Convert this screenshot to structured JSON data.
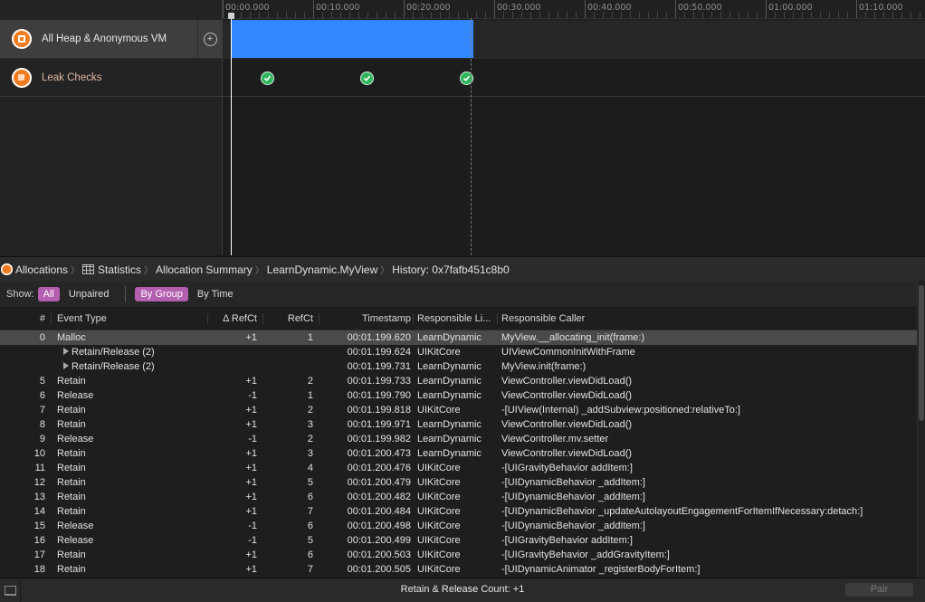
{
  "timeline": {
    "ticks": [
      "00:00.000",
      "00:10.000",
      "00:20.000",
      "00:30.000",
      "00:40.000",
      "00:50.000",
      "01:00.000",
      "01:10.000"
    ]
  },
  "tracks": [
    {
      "label": "All Heap & Anonymous VM",
      "icon": "allocations-icon"
    },
    {
      "label": "Leak Checks",
      "icon": "leaks-icon"
    }
  ],
  "colors": {
    "accent_bar": "#3287ff",
    "instrument_orange": "#f07c21",
    "leak_green": "#2fb45a",
    "filter_active": "#b45eb0"
  },
  "breadcrumb": {
    "items": [
      "Allocations",
      "Statistics",
      "Allocation Summary",
      "LearnDynamic.MyView",
      "History: 0x7fafb451c8b0"
    ]
  },
  "filter": {
    "show_label": "Show:",
    "all": "All",
    "unpaired": "Unpaired",
    "by_group": "By Group",
    "by_time": "By Time"
  },
  "table": {
    "headers": [
      "#",
      "Event Type",
      "Δ RefCt",
      "RefCt",
      "Timestamp",
      "Responsible Li...",
      "Responsible Caller"
    ],
    "rows": [
      {
        "num": "0",
        "event": "Malloc",
        "delta": "+1",
        "refct": "1",
        "ts": "00:01.199.620",
        "lib": "LearnDynamic",
        "caller": "MyView.__allocating_init(frame:)",
        "selected": true
      },
      {
        "num": "",
        "event": "Retain/Release (2)",
        "delta": "",
        "refct": "",
        "ts": "00:01.199.624",
        "lib": "UIKitCore",
        "caller": "UIViewCommonInitWithFrame",
        "group": true
      },
      {
        "num": "",
        "event": "Retain/Release (2)",
        "delta": "",
        "refct": "",
        "ts": "00:01.199.731",
        "lib": "LearnDynamic",
        "caller": "MyView.init(frame:)",
        "group": true
      },
      {
        "num": "5",
        "event": "Retain",
        "delta": "+1",
        "refct": "2",
        "ts": "00:01.199.733",
        "lib": "LearnDynamic",
        "caller": "ViewController.viewDidLoad()"
      },
      {
        "num": "6",
        "event": "Release",
        "delta": "-1",
        "refct": "1",
        "ts": "00:01.199.790",
        "lib": "LearnDynamic",
        "caller": "ViewController.viewDidLoad()"
      },
      {
        "num": "7",
        "event": "Retain",
        "delta": "+1",
        "refct": "2",
        "ts": "00:01.199.818",
        "lib": "UIKitCore",
        "caller": "-[UIView(Internal) _addSubview:positioned:relativeTo:]"
      },
      {
        "num": "8",
        "event": "Retain",
        "delta": "+1",
        "refct": "3",
        "ts": "00:01.199.971",
        "lib": "LearnDynamic",
        "caller": "ViewController.viewDidLoad()"
      },
      {
        "num": "9",
        "event": "Release",
        "delta": "-1",
        "refct": "2",
        "ts": "00:01.199.982",
        "lib": "LearnDynamic",
        "caller": "ViewController.mv.setter"
      },
      {
        "num": "10",
        "event": "Retain",
        "delta": "+1",
        "refct": "3",
        "ts": "00:01.200.473",
        "lib": "LearnDynamic",
        "caller": "ViewController.viewDidLoad()"
      },
      {
        "num": "11",
        "event": "Retain",
        "delta": "+1",
        "refct": "4",
        "ts": "00:01.200.476",
        "lib": "UIKitCore",
        "caller": "-[UIGravityBehavior addItem:]"
      },
      {
        "num": "12",
        "event": "Retain",
        "delta": "+1",
        "refct": "5",
        "ts": "00:01.200.479",
        "lib": "UIKitCore",
        "caller": "-[UIDynamicBehavior _addItem:]"
      },
      {
        "num": "13",
        "event": "Retain",
        "delta": "+1",
        "refct": "6",
        "ts": "00:01.200.482",
        "lib": "UIKitCore",
        "caller": "-[UIDynamicBehavior _addItem:]"
      },
      {
        "num": "14",
        "event": "Retain",
        "delta": "+1",
        "refct": "7",
        "ts": "00:01.200.484",
        "lib": "UIKitCore",
        "caller": "-[UIDynamicBehavior _updateAutolayoutEngagementForItemIfNecessary:detach:]"
      },
      {
        "num": "15",
        "event": "Release",
        "delta": "-1",
        "refct": "6",
        "ts": "00:01.200.498",
        "lib": "UIKitCore",
        "caller": "-[UIDynamicBehavior _addItem:]"
      },
      {
        "num": "16",
        "event": "Release",
        "delta": "-1",
        "refct": "5",
        "ts": "00:01.200.499",
        "lib": "UIKitCore",
        "caller": "-[UIGravityBehavior addItem:]"
      },
      {
        "num": "17",
        "event": "Retain",
        "delta": "+1",
        "refct": "6",
        "ts": "00:01.200.503",
        "lib": "UIKitCore",
        "caller": "-[UIGravityBehavior _addGravityItem:]"
      },
      {
        "num": "18",
        "event": "Retain",
        "delta": "+1",
        "refct": "7",
        "ts": "00:01.200.505",
        "lib": "UIKitCore",
        "caller": "-[UIDynamicAnimator _registerBodyForItem:]"
      }
    ]
  },
  "status": {
    "count_text": "Retain & Release Count: +1",
    "pair_label": "Pair"
  }
}
